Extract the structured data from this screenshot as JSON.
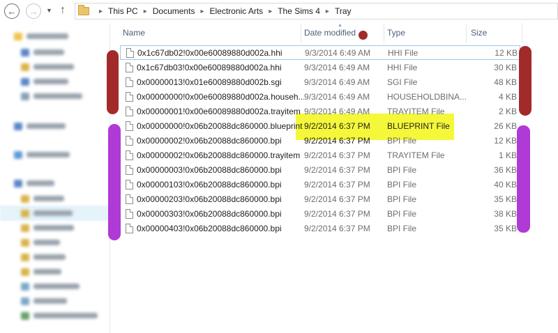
{
  "window": {
    "back_icon": "arrow-left-icon",
    "forward_icon": "arrow-right-icon",
    "up_icon": "arrow-up-icon"
  },
  "breadcrumb": [
    "This PC",
    "Documents",
    "Electronic Arts",
    "The Sims 4",
    "Tray"
  ],
  "columns": {
    "name": "Name",
    "date": "Date modified",
    "type": "Type",
    "size": "Size"
  },
  "files": [
    {
      "name": "0x1c67db02!0x00e60089880d002a.hhi",
      "date": "9/3/2014 6:49 AM",
      "type": "HHI File",
      "size": "12 KB"
    },
    {
      "name": "0x1c67db03!0x00e60089880d002a.hhi",
      "date": "9/3/2014 6:49 AM",
      "type": "HHI File",
      "size": "30 KB"
    },
    {
      "name": "0x00000013!0x01e60089880d002b.sgi",
      "date": "9/3/2014 6:49 AM",
      "type": "SGI File",
      "size": "48 KB"
    },
    {
      "name": "0x00000000!0x00e60089880d002a.househ...",
      "date": "9/3/2014 6:49 AM",
      "type": "HOUSEHOLDBINA...",
      "size": "4 KB"
    },
    {
      "name": "0x00000001!0x00e60089880d002a.trayitem",
      "date": "9/3/2014 6:49 AM",
      "type": "TRAYITEM File",
      "size": "2 KB"
    },
    {
      "name": "0x00000000!0x06b20088dc860000.blueprint",
      "date": "9/2/2014 6:37 PM",
      "type": "BLUEPRINT File",
      "size": "26 KB"
    },
    {
      "name": "0x00000002!0x06b20088dc860000.bpi",
      "date": "9/2/2014 6:37 PM",
      "type": "BPI File",
      "size": "12 KB"
    },
    {
      "name": "0x00000002!0x06b20088dc860000.trayitem",
      "date": "9/2/2014 6:37 PM",
      "type": "TRAYITEM File",
      "size": "1 KB"
    },
    {
      "name": "0x00000003!0x06b20088dc860000.bpi",
      "date": "9/2/2014 6:37 PM",
      "type": "BPI File",
      "size": "36 KB"
    },
    {
      "name": "0x00000103!0x06b20088dc860000.bpi",
      "date": "9/2/2014 6:37 PM",
      "type": "BPI File",
      "size": "40 KB"
    },
    {
      "name": "0x00000203!0x06b20088dc860000.bpi",
      "date": "9/2/2014 6:37 PM",
      "type": "BPI File",
      "size": "35 KB"
    },
    {
      "name": "0x00000303!0x06b20088dc860000.bpi",
      "date": "9/2/2014 6:37 PM",
      "type": "BPI File",
      "size": "38 KB"
    },
    {
      "name": "0x00000403!0x06b20088dc860000.bpi",
      "date": "9/2/2014 6:37 PM",
      "type": "BPI File",
      "size": "35 KB"
    }
  ],
  "annotations": {
    "dark_red": "#a32a2a",
    "purple": "#b03ad6",
    "yellow": "#f5f73a"
  }
}
